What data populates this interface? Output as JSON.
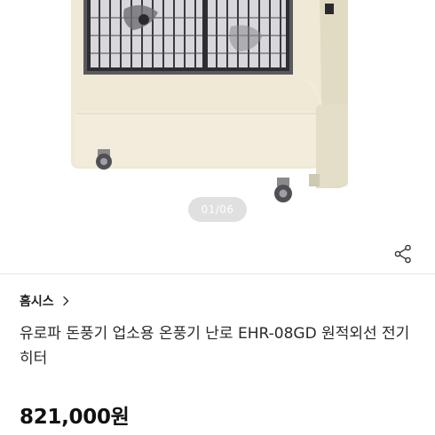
{
  "gallery": {
    "indicator": "01/06",
    "image_alt": "product-photo"
  },
  "share": {
    "icon": "share-icon"
  },
  "product": {
    "brand": "홈시스",
    "title": "유로파 돈풍기 업소용 온풍기 난로 EHR-08GD 원적외선 전기 히터",
    "price": "821,000원"
  },
  "colors": {
    "heater_body": "#efe9d6",
    "heater_shadow": "#dcd5be",
    "grille_dark": "#3c3c40",
    "text_primary": "#222222"
  }
}
